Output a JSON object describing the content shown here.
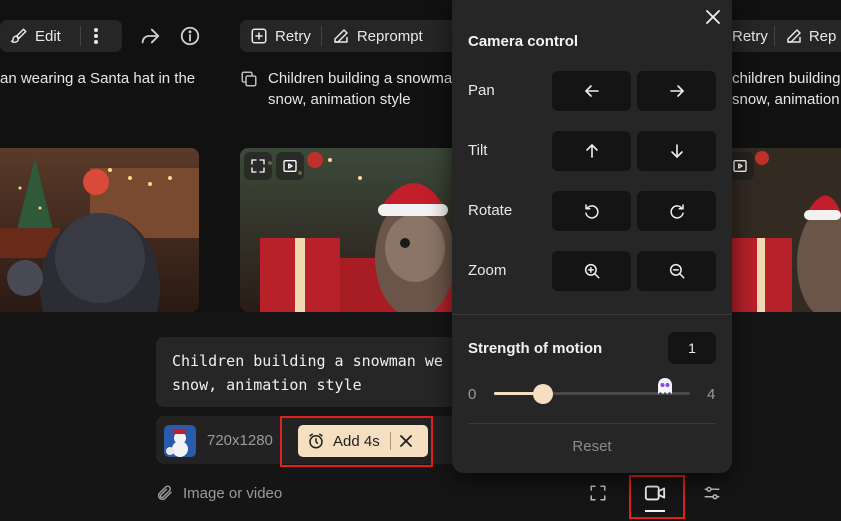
{
  "toolbar_left": {
    "edit_label": "Edit"
  },
  "toolbar_mid": {
    "retry_label": "Retry",
    "reprompt_label": "Reprompt"
  },
  "toolbar_right": {
    "retry_label": "Retry",
    "reprompt_label": "Rep"
  },
  "prompts": {
    "left": "an wearing a Santa hat in the",
    "mid_line1": "Children building a snowman",
    "mid_line2": "snow, animation style",
    "right_line1": "children building a snowm",
    "right_line2": "snow, animation sty"
  },
  "composer": {
    "prompt_line1": "Children building a snowman we",
    "prompt_line2": "snow, animation style",
    "resolution": "720x1280",
    "add_label": "Add 4s",
    "attach_label": "Image or video"
  },
  "camera_panel": {
    "title": "Camera control",
    "rows": [
      {
        "label": "Pan",
        "left_icon": "arrow-left-icon",
        "right_icon": "arrow-right-icon"
      },
      {
        "label": "Tilt",
        "left_icon": "arrow-up-icon",
        "right_icon": "arrow-down-icon"
      },
      {
        "label": "Rotate",
        "left_icon": "rotate-ccw-icon",
        "right_icon": "rotate-cw-icon"
      },
      {
        "label": "Zoom",
        "left_icon": "zoom-in-icon",
        "right_icon": "zoom-out-icon"
      }
    ],
    "strength_label": "Strength of motion",
    "strength_value": "1",
    "slider_min": "0",
    "slider_max": "4",
    "slider_value": 1,
    "reset_label": "Reset"
  },
  "colors": {
    "background": "#111111",
    "panel": "#262626",
    "button": "#141414",
    "accent": "#f5dfc0",
    "highlight": "#e0201c"
  }
}
